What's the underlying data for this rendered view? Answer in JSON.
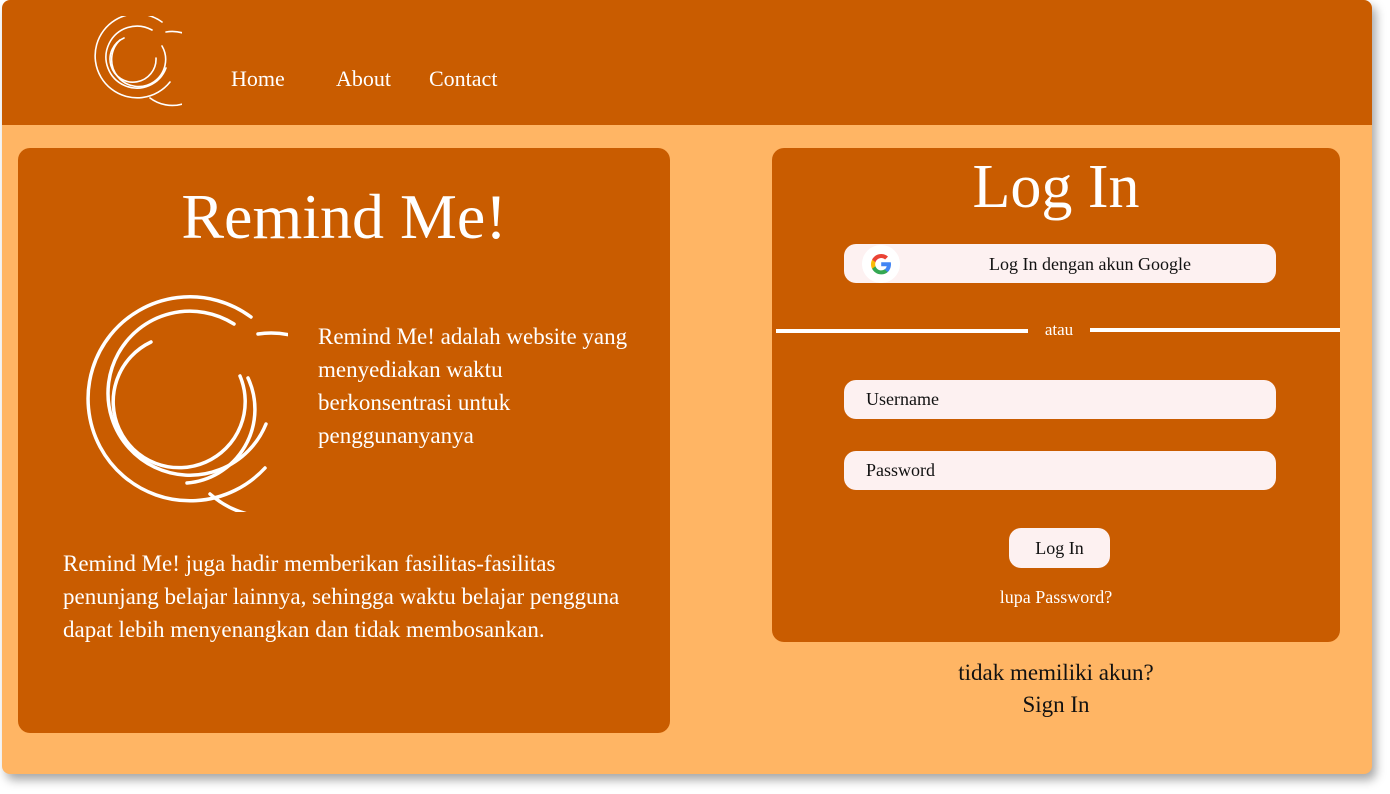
{
  "nav": {
    "logo_icon": "concentric-arcs-logo-icon",
    "items": [
      {
        "label": "Home"
      },
      {
        "label": "About"
      },
      {
        "label": "Contact"
      }
    ]
  },
  "info": {
    "title": "Remind Me!",
    "logo_icon": "concentric-arcs-logo-icon",
    "description": "Remind Me! adalah website yang menyediakan waktu berkonsentrasi untuk penggunanyanya",
    "extra": "Remind Me! juga hadir memberikan fasilitas-fasilitas penunjang belajar lainnya, sehingga waktu belajar pengguna dapat lebih menyenangkan dan tidak membosankan."
  },
  "login": {
    "title": "Log In",
    "google_icon": "google-icon",
    "google_label": "Log In dengan akun Google",
    "divider_text": "atau",
    "username_placeholder": "Username",
    "password_placeholder": "Password",
    "submit_label": "Log In",
    "forgot_label": "lupa Password?"
  },
  "signup": {
    "prompt": "tidak memiliki akun?",
    "link_label": "Sign In"
  },
  "colors": {
    "background": "#ffb564",
    "panel": "#c95c00",
    "field": "#fdf1f1",
    "text_light": "#ffffff",
    "text_dark": "#111111"
  }
}
